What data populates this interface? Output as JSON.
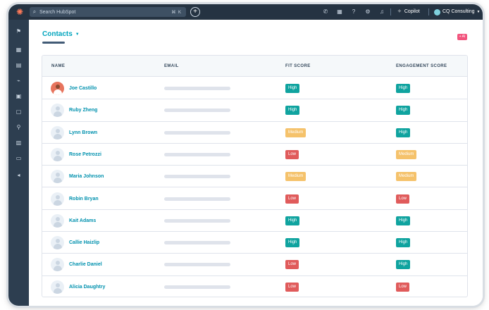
{
  "topbar": {
    "search_placeholder": "Search HubSpot",
    "search_shortcut": "⌘ K",
    "copilot_label": "Copilot",
    "account_name": "CQ Consulting"
  },
  "page": {
    "title": "Contacts",
    "corner_badge": "+ AI"
  },
  "table": {
    "headers": {
      "name": "NAME",
      "email": "EMAIL",
      "fit": "FIT SCORE",
      "engagement": "ENGAGEMENT SCORE"
    },
    "rows": [
      {
        "name": "Joe Castillo",
        "fit": "High",
        "engagement": "High"
      },
      {
        "name": "Ruby Zheng",
        "fit": "High",
        "engagement": "High"
      },
      {
        "name": "Lynn Brown",
        "fit": "Medium",
        "engagement": "High"
      },
      {
        "name": "Rose Petrozzi",
        "fit": "Low",
        "engagement": "Medium"
      },
      {
        "name": "Maria Johnson",
        "fit": "Medium",
        "engagement": "Medium"
      },
      {
        "name": "Robin Bryan",
        "fit": "Low",
        "engagement": "Low"
      },
      {
        "name": "Kait Adams",
        "fit": "High",
        "engagement": "High"
      },
      {
        "name": "Callie Haizlip",
        "fit": "High",
        "engagement": "High"
      },
      {
        "name": "Charlie Daniel",
        "fit": "Low",
        "engagement": "High"
      },
      {
        "name": "Alicia Daughtry",
        "fit": "Low",
        "engagement": "Low"
      }
    ]
  },
  "colors": {
    "high": "#0fa39f",
    "medium": "#f5c26b",
    "low": "#e05b5b",
    "accent": "#00a4bd",
    "topbar": "#253342"
  }
}
